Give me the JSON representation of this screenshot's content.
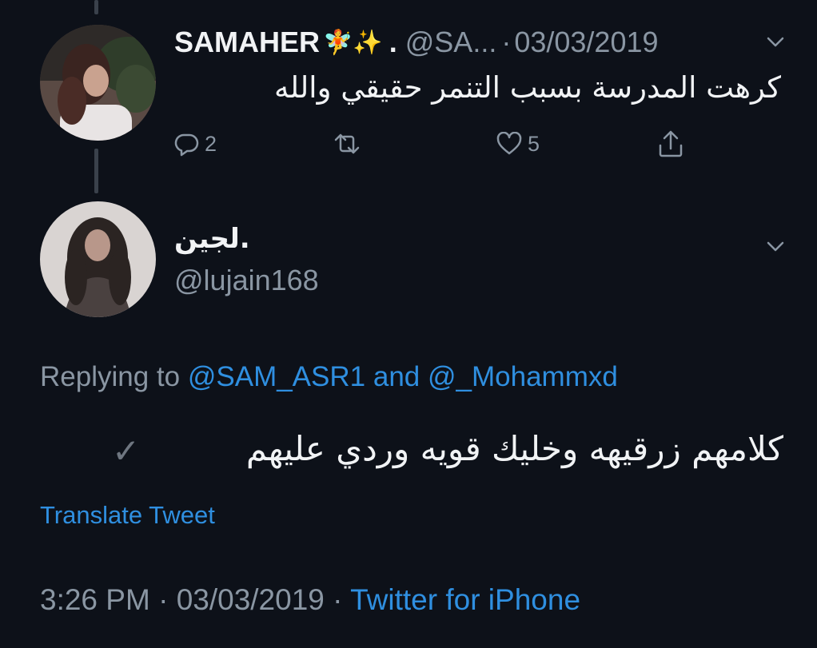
{
  "tweet1": {
    "display_name": "SAMAHER",
    "name_emoji": "🧚✨",
    "name_dot": ".",
    "handle": "@SA...",
    "date": "03/03/2019",
    "text": "كرهت المدرسة بسبب التنمر حقيقي والله",
    "reply_count": "2",
    "like_count": "5",
    "avatar_icon": "profile-photo"
  },
  "tweet2": {
    "display_name": "لجين.",
    "handle": "@lujain168",
    "replying_prefix": "Replying to",
    "reply_to_1": "@SAM_ASR1",
    "reply_and": "and",
    "reply_to_2": "@_Mohammxd",
    "text": "كلامهم زرقيهه وخليك قويه وردي عليهم",
    "check_glyph": "✓",
    "translate_label": "Translate Tweet",
    "time": "3:26 PM",
    "date": "03/03/2019",
    "source": "Twitter for iPhone",
    "separator": "·"
  },
  "colors": {
    "background": "#0d1119",
    "text_primary": "#f1f3f5",
    "text_secondary": "#8a96a3",
    "link": "#2f8fe0",
    "thread_line": "#3a414b"
  }
}
